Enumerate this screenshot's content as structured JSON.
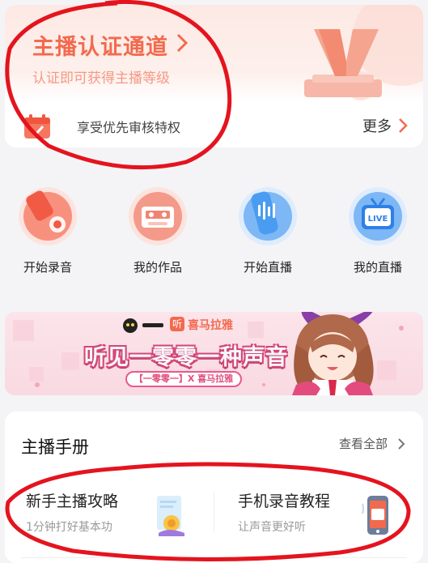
{
  "certification": {
    "title": "主播认证通道",
    "subtitle": "认证即可获得主播等级",
    "privilege": "享受优先审核特权",
    "more_label": "更多"
  },
  "actions": [
    {
      "label": "开始录音",
      "icon": "microphone-icon",
      "color": "#f6735e"
    },
    {
      "label": "我的作品",
      "icon": "cassette-icon",
      "color": "#f08474"
    },
    {
      "label": "开始直播",
      "icon": "live-voice-icon",
      "color": "#4a9cf0"
    },
    {
      "label": "我的直播",
      "icon": "tv-live-icon",
      "color": "#4a9cf0"
    }
  ],
  "banner": {
    "partner_logo": "听",
    "partner_name": "喜马拉雅",
    "headline": "听见一零零一种声音",
    "pill": "【一零零一】X 喜马拉雅"
  },
  "handbook": {
    "title": "主播手册",
    "view_all": "查看全部",
    "items": [
      {
        "title": "新手主播攻略",
        "subtitle": "1分钟打好基本功"
      },
      {
        "title": "手机录音教程",
        "subtitle": "让声音更好听"
      }
    ]
  },
  "colors": {
    "accent": "#f26a4e",
    "blue": "#4a9cf0",
    "annotation": "#e4141e"
  }
}
